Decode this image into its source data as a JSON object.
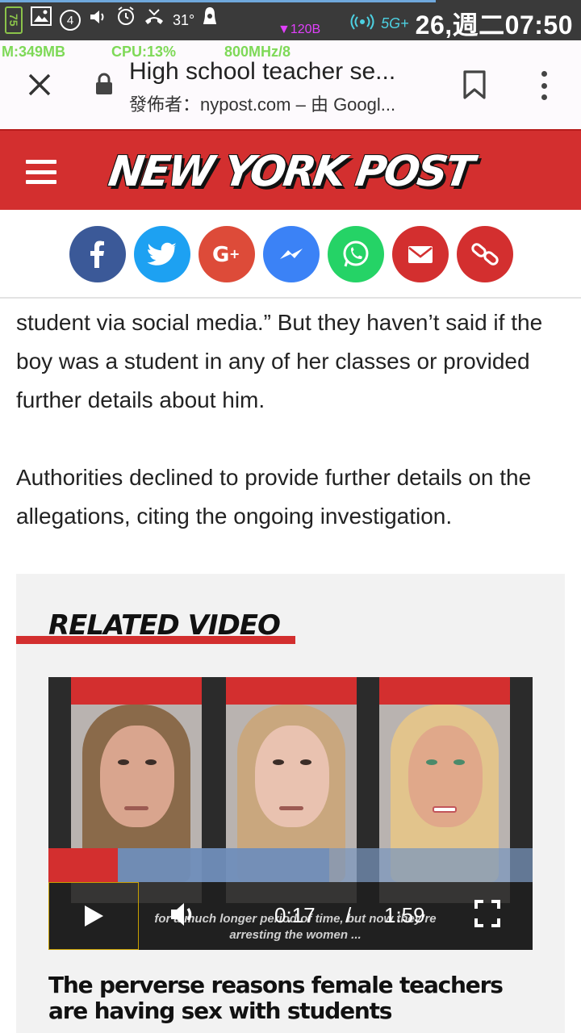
{
  "status_bar": {
    "battery": "75",
    "notification_count": "4",
    "temperature": "31°",
    "net_speed": "▼120B",
    "network": "5G+",
    "clock": "26,週二07:50"
  },
  "overlay_stats": {
    "memory": "M:349MB",
    "cpu": "CPU:13%",
    "frequency": "800MHz/8"
  },
  "toolbar": {
    "title": "High school teacher se...",
    "subtitle": "發佈者：nypost.com – 由 Googl..."
  },
  "header": {
    "logo_text": "NEW YORK POST"
  },
  "share": {
    "buttons": [
      {
        "name": "facebook",
        "color": "#3b5998"
      },
      {
        "name": "twitter",
        "color": "#1da1f2"
      },
      {
        "name": "google-plus",
        "color": "#dd4b39"
      },
      {
        "name": "messenger",
        "color": "#3b82f6"
      },
      {
        "name": "whatsapp",
        "color": "#25d366"
      },
      {
        "name": "email",
        "color": "#d32f2f"
      },
      {
        "name": "link",
        "color": "#d32f2f"
      }
    ]
  },
  "article": {
    "paragraphs": [
      "student via social media.” But they haven’t said if the boy was a student in any of her classes or provided further details about him.",
      "Authorities declined to provide further details on the allegations, citing the ongoing investigation."
    ]
  },
  "related": {
    "heading": "RELATED VIDEO",
    "video": {
      "caption_line1": "for a much longer period of time, but now they’re",
      "caption_line2": "arresting the women ...",
      "current_time": "0:17",
      "separator": "/",
      "duration": "1:59",
      "played_fraction": 0.143
    },
    "title": "The perverse reasons female teachers are having sex with students"
  }
}
